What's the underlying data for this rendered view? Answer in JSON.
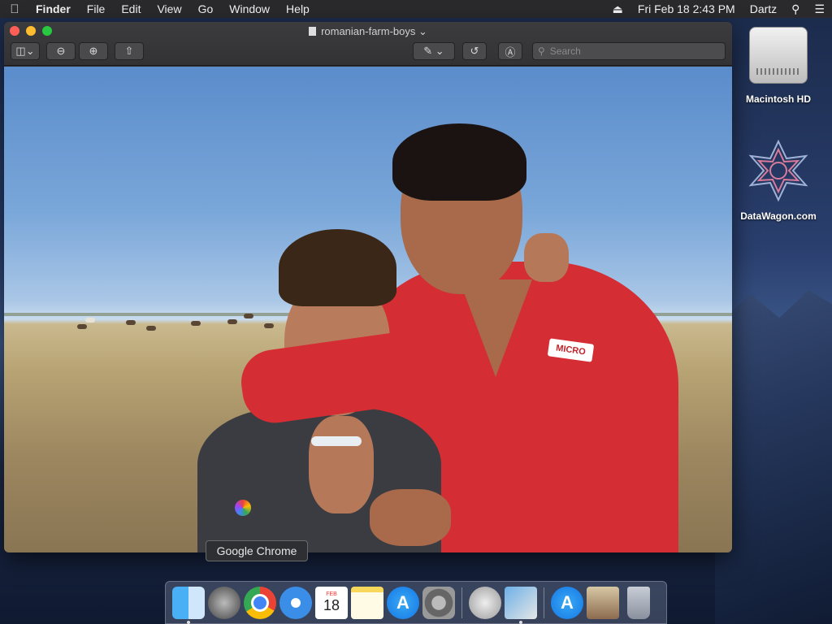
{
  "menubar": {
    "apple_label": "",
    "app_name": "Finder",
    "menus": [
      "File",
      "Edit",
      "View",
      "Go",
      "Window",
      "Help"
    ],
    "datetime": "Fri Feb 18  2:43 PM",
    "user": "Dartz"
  },
  "window": {
    "title": "romanian-farm-boys",
    "search_placeholder": "Search",
    "photo_logo_text": "MICRO"
  },
  "desktop": {
    "drive_label": "Macintosh HD",
    "datawagon_label": "DataWagon.com"
  },
  "dock": {
    "tooltip": "Google Chrome",
    "calendar_month": "FEB",
    "calendar_day": "18",
    "app_store_glyph": "A"
  },
  "colors": {
    "menubar_bg": "#2a2a2c",
    "window_bg": "#2f2f31",
    "accent_red": "#d42d33"
  }
}
